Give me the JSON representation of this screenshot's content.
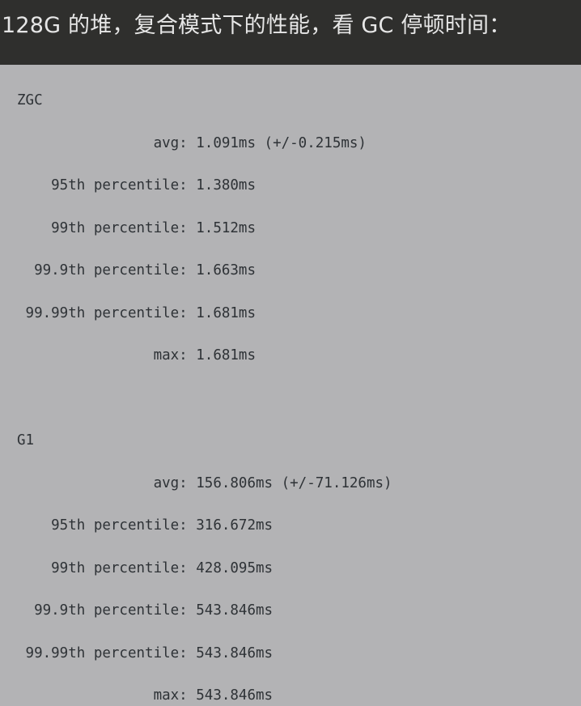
{
  "heading": "128G 的堆，复合模式下的性能，看 GC 停顿时间：",
  "code_lines": [
    "ZGC",
    "                avg: 1.091ms (+/-0.215ms)",
    "    95th percentile: 1.380ms",
    "    99th percentile: 1.512ms",
    "  99.9th percentile: 1.663ms",
    " 99.99th percentile: 1.681ms",
    "                max: 1.681ms",
    "",
    "G1",
    "                avg: 156.806ms (+/-71.126ms)",
    "    95th percentile: 316.672ms",
    "    99th percentile: 428.095ms",
    "  99.9th percentile: 543.846ms",
    " 99.99th percentile: 543.846ms",
    "                max: 543.846ms"
  ],
  "colors": {
    "heading_background": "#2f2f2d",
    "heading_text": "#e6e6e6",
    "code_background": "#b3b3b5",
    "code_text": "#2e3236"
  }
}
